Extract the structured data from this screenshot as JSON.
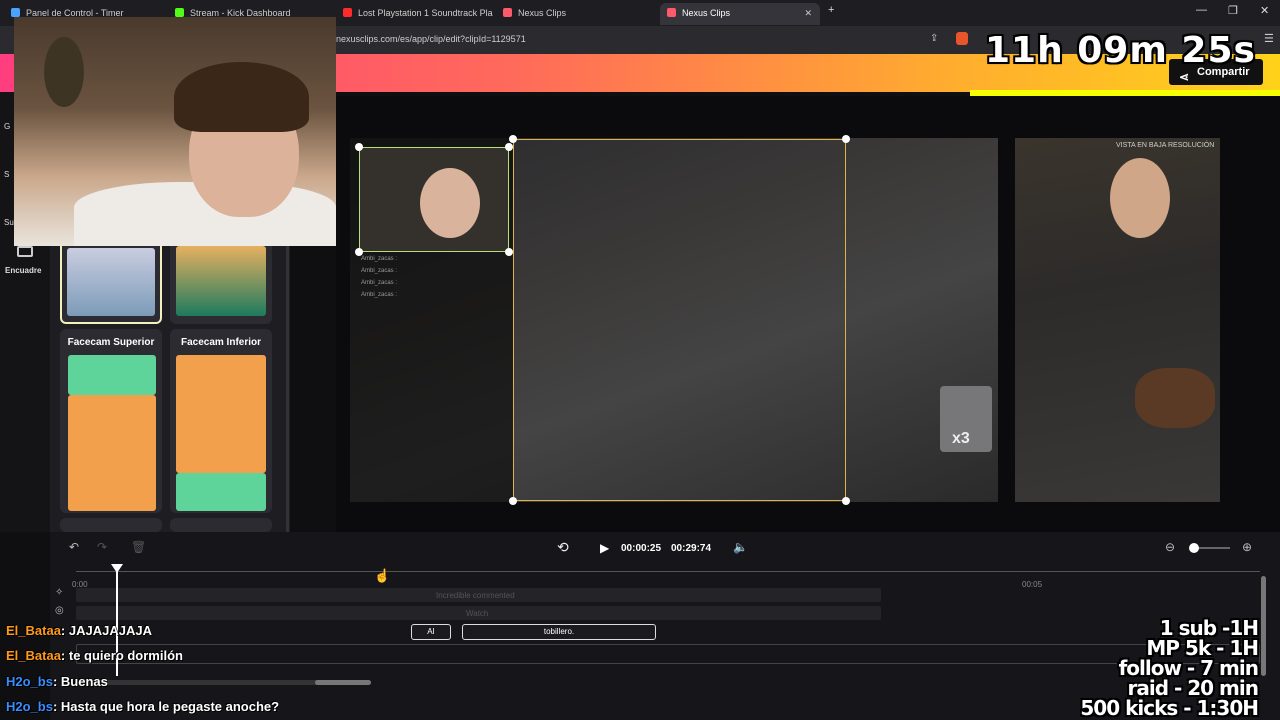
{
  "browser": {
    "tabs": [
      {
        "label": "Panel de Control - Timer",
        "color": "#4aa3ff"
      },
      {
        "label": "Stream - Kick Dashboard",
        "color": "#53fc18"
      },
      {
        "label": "Lost Playstation 1 Soundtrack Pla",
        "color": "#ff2b2b"
      },
      {
        "label": "Nexus Clips",
        "color": "#ff5a6a"
      },
      {
        "label": "Nexus Clips",
        "color": "#ff5a6a"
      }
    ],
    "new_tab": "+",
    "url": "nexusclips.com/es/app/clip/edit?clipId=1129571",
    "controls": [
      "—",
      "❐",
      "✕"
    ]
  },
  "header": {
    "share_label": "Compartir",
    "share_icon": "share-icon",
    "accent": "#ffd21a"
  },
  "timer": "11h 09m 25s",
  "rail": {
    "labels": [
      "G",
      "S",
      "Su"
    ],
    "active_label": "Encuadre",
    "active_icon": "video-camera-icon"
  },
  "layouts": [
    {
      "title": "Facecam Superior"
    },
    {
      "title": "Facecam Inferior"
    }
  ],
  "editor": {
    "preview_badge": "VISTA EN BAJA RESOLUCIÓN",
    "mini_chat": [
      "Ambi_zacas :",
      "Ambi_zacas :",
      "Ambi_zacas :",
      "Ambi_zacas :"
    ],
    "sticker_text": "x3"
  },
  "timeline": {
    "current_time": "00:00:25",
    "total_time": "00:29:74",
    "tick_labels": [
      "0:00",
      "00:05"
    ],
    "track_labels": [
      "Incredible commented",
      "Watch"
    ],
    "segments": [
      "AI",
      "tobillero."
    ]
  },
  "chat": [
    {
      "user": "El_Bataa",
      "message": ": JAJAJAJAJA",
      "color": "#ff9a1a"
    },
    {
      "user": "El_Bataa",
      "message": ": te quiero dormilón",
      "color": "#ff9a1a"
    },
    {
      "user": "H2o_bs",
      "message": ": Buenas",
      "color": "#3a8dff"
    },
    {
      "user": "H2o_bs",
      "message": ": Hasta que hora le pegaste anoche?",
      "color": "#3a8dff"
    }
  ],
  "goals": [
    "1 sub -1H",
    "MP 5k - 1H",
    "follow - 7 min",
    "raid - 20 min",
    "500 kicks - 1:30H"
  ]
}
